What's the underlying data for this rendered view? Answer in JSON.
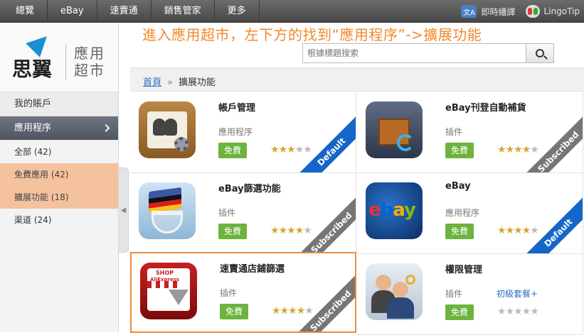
{
  "topnav": {
    "items": [
      "總覽",
      "eBay",
      "速賣通",
      "銷售管家",
      "更多"
    ],
    "translate_label": "即時繙譯",
    "translate_icon_text": "文A",
    "lingotip_label": "LingoTip"
  },
  "sidebar": {
    "brand": "思翼",
    "subtitle": "應用超市",
    "account": "我的賬戶",
    "apps": "應用程序",
    "sub_items": [
      "全部 (42)",
      "免費應用 (42)",
      "擴展功能 (18)",
      "渠道 (24)"
    ]
  },
  "banner": "進入應用超市，左下方的找到“應用程序”->擴展功能",
  "search": {
    "placeholder": "根據標題搜索"
  },
  "breadcrumb": {
    "home": "首頁",
    "sep": "»",
    "current": "擴展功能"
  },
  "cards": [
    {
      "title": "帳戶管理",
      "type": "應用程序",
      "button": "免費",
      "rating": 3,
      "ribbon": "Default",
      "extra": ""
    },
    {
      "title": "eBay刊登自動補貨",
      "type": "插件",
      "button": "免費",
      "rating": 4,
      "ribbon": "Subscribed",
      "extra": ""
    },
    {
      "title": "eBay篩選功能",
      "type": "插件",
      "button": "免費",
      "rating": 4,
      "ribbon": "Subscribed",
      "extra": ""
    },
    {
      "title": "eBay",
      "type": "應用程序",
      "button": "免費",
      "rating": 4,
      "ribbon": "Default",
      "extra": ""
    },
    {
      "title": "速賣通店鋪篩選",
      "type": "插件",
      "button": "免費",
      "rating": 4,
      "ribbon": "Subscribed",
      "extra": ""
    },
    {
      "title": "權限管理",
      "type": "插件",
      "button": "免費",
      "rating": 0,
      "ribbon": "",
      "extra": "初級套餐+"
    }
  ],
  "icon_text": {
    "ebay": [
      "e",
      "b",
      "a",
      "y"
    ],
    "shop_label": "SHOP",
    "ali_label": "AliExpress"
  },
  "colors": {
    "ebay": [
      "#e53238",
      "#0064d2",
      "#f5af02",
      "#86b817"
    ],
    "accent": "#f08a2a",
    "free_button": "#6db33f",
    "ribbon_default": "#1566c8",
    "ribbon_subscribed": "#767676"
  }
}
